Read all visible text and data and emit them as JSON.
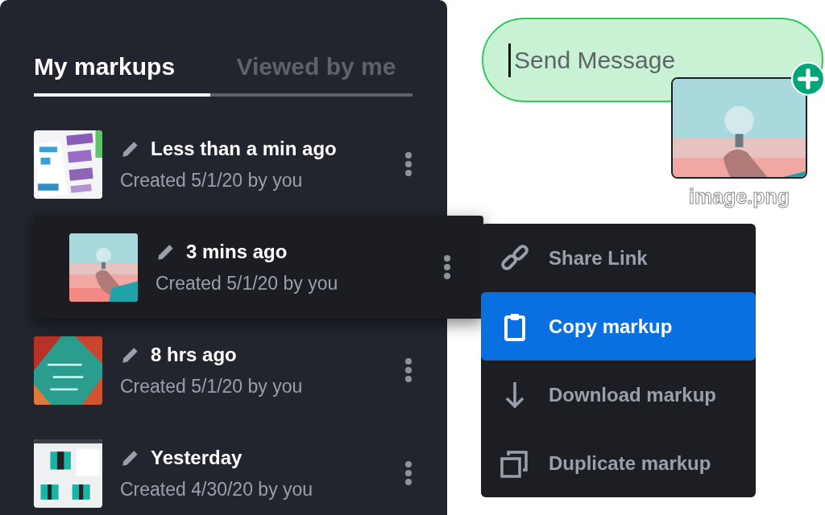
{
  "tabs": [
    {
      "label": "My markups",
      "selected": true
    },
    {
      "label": "Viewed by me",
      "selected": false
    }
  ],
  "markups": [
    {
      "edited": "Less than a min ago",
      "created": "Created 5/1/20 by you",
      "lifted": false
    },
    {
      "edited": "3 mins ago",
      "created": "Created 5/1/20 by you",
      "lifted": true
    },
    {
      "edited": "8 hrs ago",
      "created": "Created 5/1/20 by you",
      "lifted": false
    },
    {
      "edited": "Yesterday",
      "created": "Created 4/30/20 by you",
      "lifted": false
    }
  ],
  "context_menu": {
    "items": [
      {
        "label": "Share Link",
        "selected": false
      },
      {
        "label": "Copy markup",
        "selected": true
      },
      {
        "label": "Download markup",
        "selected": false
      },
      {
        "label": "Duplicate markup",
        "selected": false
      }
    ]
  },
  "composer": {
    "placeholder": "Send Message",
    "attachment": {
      "filename": "image.png"
    }
  }
}
